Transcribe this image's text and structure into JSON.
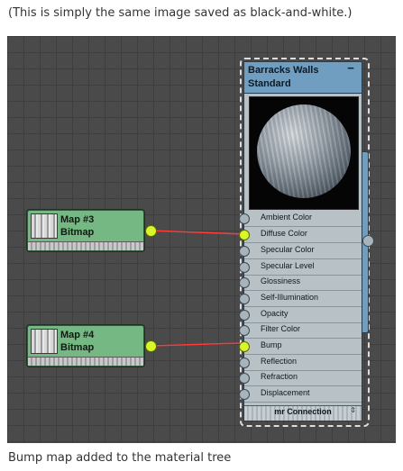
{
  "captions": {
    "top": "(This is simply the same image saved as black-and-white.)",
    "bottom": "Bump map added to the material tree"
  },
  "colors": {
    "viewport_bg": "#4a4a4a",
    "map_node": "#75b883",
    "material_header": "#6f9ec1",
    "material_body": "#b7c1c6",
    "wire": "#ff3a3a",
    "active_socket": "#d8f62a"
  },
  "map_nodes": [
    {
      "title": "Map #3",
      "subtitle": "Bitmap",
      "connected_to": "Diffuse Color"
    },
    {
      "title": "Map #4",
      "subtitle": "Bitmap",
      "connected_to": "Bump"
    }
  ],
  "material": {
    "name": "Barracks Walls",
    "type": "Standard",
    "collapse_symbol": "−",
    "preview_icon": "sphere-preview",
    "slots": [
      {
        "label": "Ambient Color",
        "connected": false
      },
      {
        "label": "Diffuse Color",
        "connected": true
      },
      {
        "label": "Specular Color",
        "connected": false
      },
      {
        "label": "Specular Level",
        "connected": false
      },
      {
        "label": "Glossiness",
        "connected": false
      },
      {
        "label": "Self-Illumination",
        "connected": false
      },
      {
        "label": "Opacity",
        "connected": false
      },
      {
        "label": "Filter Color",
        "connected": false
      },
      {
        "label": "Bump",
        "connected": true
      },
      {
        "label": "Reflection",
        "connected": false
      },
      {
        "label": "Refraction",
        "connected": false
      },
      {
        "label": "Displacement",
        "connected": false
      }
    ],
    "footer_label": "mr Connection"
  }
}
